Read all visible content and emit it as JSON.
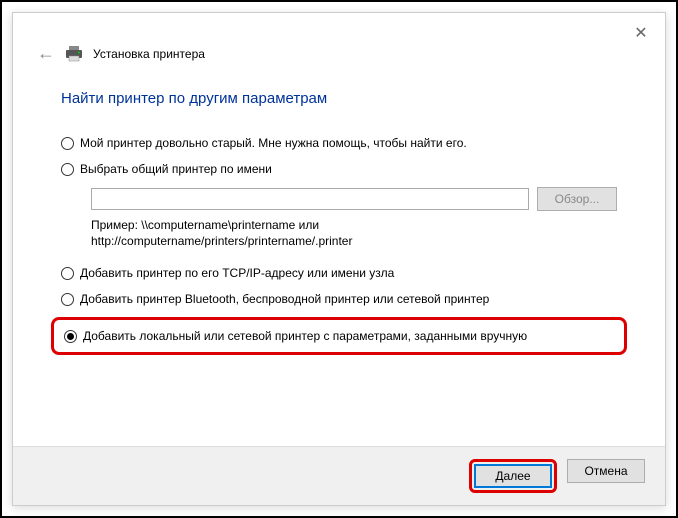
{
  "header": {
    "title": "Установка принтера"
  },
  "heading": "Найти принтер по другим параметрам",
  "options": {
    "old_printer": "Мой принтер довольно старый. Мне нужна помощь, чтобы найти его.",
    "shared_by_name": "Выбрать общий принтер по имени",
    "tcp_ip": "Добавить принтер по его TCP/IP-адресу или имени узла",
    "bluetooth": "Добавить принтер Bluetooth, беспроводной принтер или сетевой принтер",
    "manual": "Добавить локальный или сетевой принтер с параметрами, заданными вручную"
  },
  "shared_input": {
    "value": "",
    "browse_label": "Обзор...",
    "example_line1": "Пример: \\\\computername\\printername или",
    "example_line2": "http://computername/printers/printername/.printer"
  },
  "footer": {
    "next": "Далее",
    "cancel": "Отмена"
  }
}
